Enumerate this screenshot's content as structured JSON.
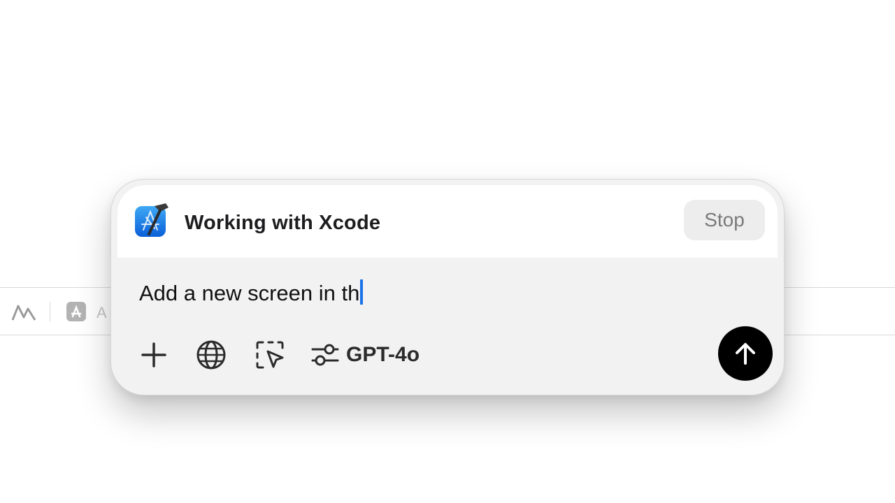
{
  "background_app": {
    "toolbar_text": "A",
    "icons": [
      "chart-glyph-icon",
      "app-store-icon"
    ]
  },
  "composer": {
    "app_icon": "xcode-icon",
    "title": "Working with Xcode",
    "stop_label": "Stop",
    "input_value": "Add a new screen in th",
    "tools": [
      "plus-icon",
      "globe-icon",
      "selection-pointer-icon",
      "sliders-icon"
    ],
    "model_label": "GPT-4o",
    "send_icon": "arrow-up-icon"
  },
  "colors": {
    "caret": "#1a73e8",
    "send_button": "#000000",
    "panel_bg": "#f2f2f2"
  }
}
